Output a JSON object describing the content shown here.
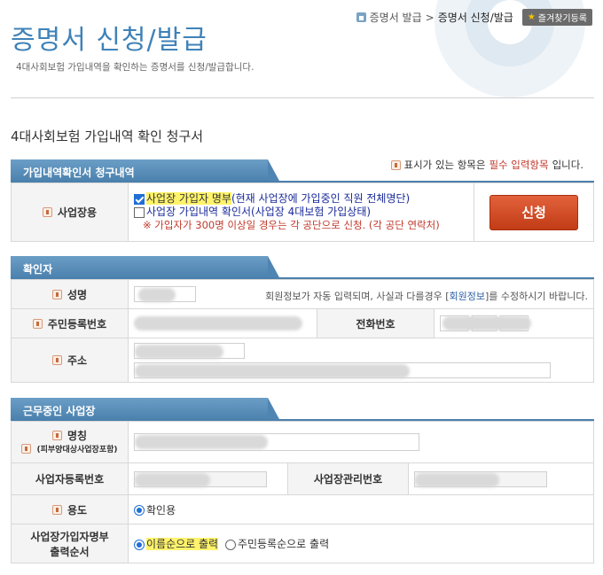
{
  "header": {
    "title": "증명서 신청/발급",
    "subtitle": "4대사회보험 가입내역을 확인하는 증명서를 신청/발급합니다.",
    "breadcrumb": {
      "parent": "증명서 발급",
      "sep": ">",
      "current": "증명서 신청/발급"
    },
    "favorite_label": "즐겨찾기등록"
  },
  "form": {
    "title": "4대사회보험 가입내역 확인 청구서",
    "required_note": {
      "pre": "표시가 있는 항목은 ",
      "emph": "필수 입력항목",
      "post": "입니다."
    }
  },
  "section1": {
    "tab": "가입내역확인서 청구내역",
    "row_label": "사업장용",
    "option1": {
      "hl": "사업장 가입자 명부",
      "rest": "(현재 사업장에 가입중인 직원 전체명단)",
      "checked": true
    },
    "option2": {
      "text": "사업장 가입내역 확인서(사업장 4대보험 가입상태)",
      "checked": false
    },
    "warning": "※ 가입자가 300명 이상일 경우는 각 공단으로 신청. (각 공단 연락처)",
    "apply_label": "신청"
  },
  "section2": {
    "tab": "확인자",
    "name_label": "성명",
    "name_note_pre": "회원정보가 자동 입력되며, 사실과 다를경우 [",
    "name_note_link": "회원정보",
    "name_note_post": "]를 수정하시기 바랍니다.",
    "rrn_label": "주민등록번호",
    "phone_label": "전화번호",
    "address_label": "주소"
  },
  "section3": {
    "tab": "근무중인 사업장",
    "biz_name_label": "명칭",
    "biz_name_sub": "(피부양대상사업장포함)",
    "biz_reg_label": "사업자등록번호",
    "biz_mgmt_label": "사업장관리번호",
    "purpose_label": "용도",
    "purpose_option": "확인용",
    "order_label_1": "사업장가입자명부",
    "order_label_2": "출력순서",
    "order_opt1": "이름순으로 출력",
    "order_opt2": "주민등록순으로 출력"
  }
}
